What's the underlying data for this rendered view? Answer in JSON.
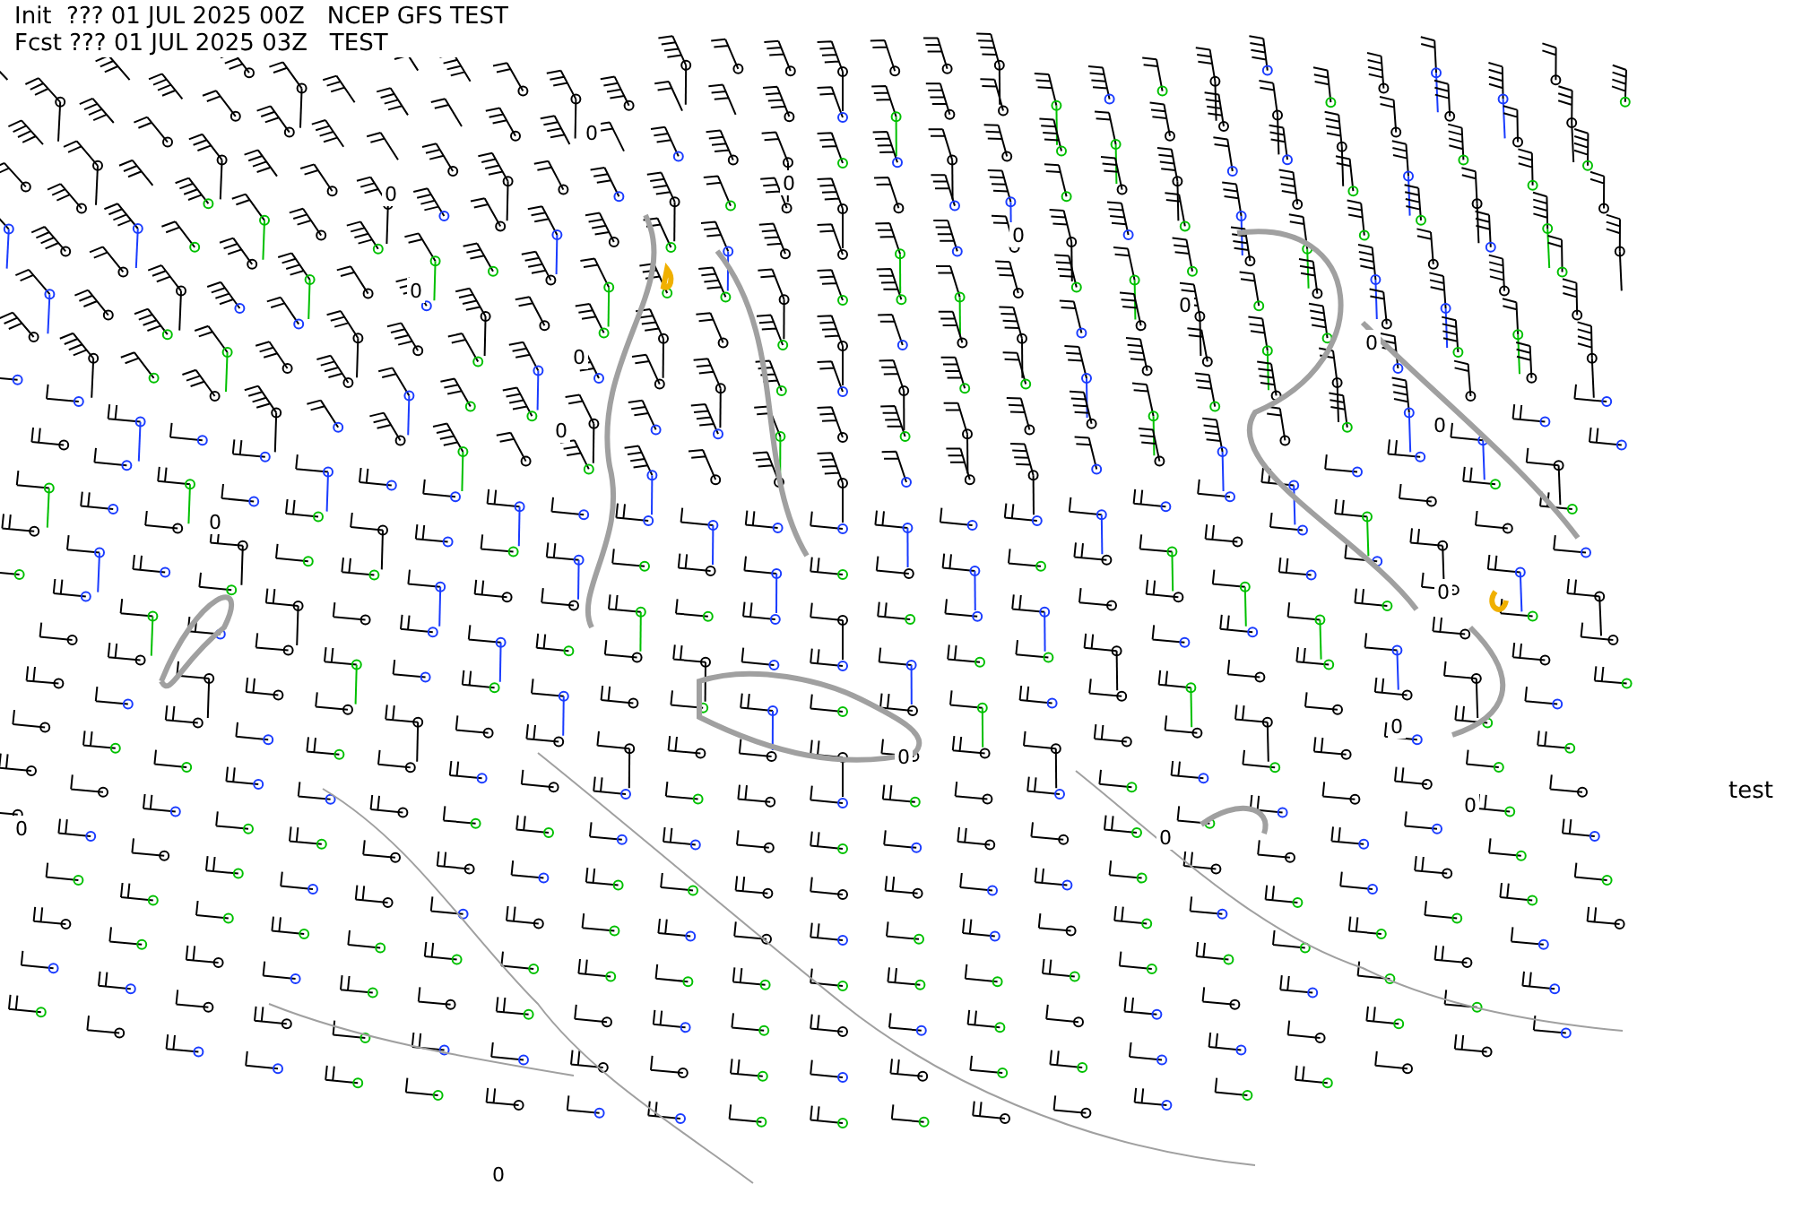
{
  "header": {
    "init_line": "Init  ??? 01 JUL 2025 00Z   NCEP GFS TEST",
    "forecast_line": "Fcst ??? 01 JUL 2025 03Z   TEST"
  },
  "side_label": "test",
  "contour_labels": [
    "0",
    "0",
    "0",
    "0",
    "0",
    "0",
    "0",
    "0",
    "0",
    "0",
    "0",
    "0",
    "0",
    "0",
    "0",
    "0",
    "0",
    "0"
  ]
}
